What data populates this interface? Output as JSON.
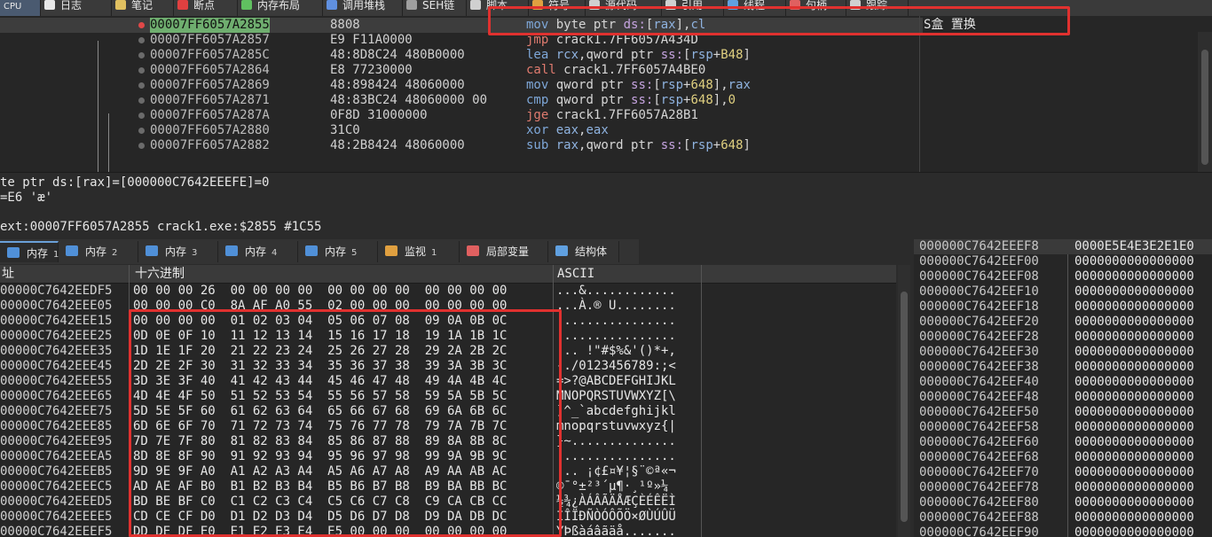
{
  "topbar": {
    "tabs": [
      {
        "label": "CPU",
        "icon": "cpu-icon",
        "color": "#5e8fd0"
      },
      {
        "label": "日志",
        "icon": "log-icon",
        "color": "#e8e8e8"
      },
      {
        "label": "笔记",
        "icon": "notes-icon",
        "color": "#e0c060"
      },
      {
        "label": "断点",
        "icon": "breakpoint-icon",
        "color": "#e04040"
      },
      {
        "label": "内存布局",
        "icon": "memory-map-icon",
        "color": "#60c060"
      },
      {
        "label": "调用堆栈",
        "icon": "call-stack-icon",
        "color": "#6090e0"
      },
      {
        "label": "SEH链",
        "icon": "seh-icon",
        "color": "#a0a0a0"
      },
      {
        "label": "脚本",
        "icon": "script-icon",
        "color": "#d0d0d0"
      },
      {
        "label": "符号",
        "icon": "symbol-icon",
        "color": "#e0a040"
      },
      {
        "label": "源代码",
        "icon": "source-icon",
        "color": "#d0d0d0"
      },
      {
        "label": "引用",
        "icon": "reference-icon",
        "color": "#d0d0d0"
      },
      {
        "label": "线程",
        "icon": "thread-icon",
        "color": "#60a0e0"
      },
      {
        "label": "句柄",
        "icon": "handle-icon",
        "color": "#e06060"
      },
      {
        "label": "跟踪",
        "icon": "trace-icon",
        "color": "#d0d0d0"
      }
    ]
  },
  "disasm": {
    "rip_label": "P",
    "rows": [
      {
        "addr": "00007FF6057A2855",
        "bytes": "8808",
        "ins": [
          [
            "mn",
            "mov"
          ],
          [
            "t",
            " byte ptr "
          ],
          [
            "seg",
            "ds:"
          ],
          [
            "t",
            "["
          ],
          [
            "reg",
            "rax"
          ],
          [
            "t",
            "],"
          ],
          [
            "reg",
            "cl"
          ]
        ],
        "current": true
      },
      {
        "addr": "00007FF6057A2857",
        "bytes": "E9 F11A0000",
        "ins": [
          [
            "mnj",
            "jmp"
          ],
          [
            "t",
            " crack1.7FF6057A434D"
          ]
        ]
      },
      {
        "addr": "00007FF6057A285C",
        "bytes": "48:8D8C24 480B0000",
        "ins": [
          [
            "mn",
            "lea"
          ],
          [
            "t",
            " "
          ],
          [
            "reg",
            "rcx"
          ],
          [
            "t",
            ",qword ptr "
          ],
          [
            "seg",
            "ss:"
          ],
          [
            "t",
            "["
          ],
          [
            "reg",
            "rsp"
          ],
          [
            "t",
            "+"
          ],
          [
            "num",
            "B48"
          ],
          [
            "t",
            "]"
          ]
        ]
      },
      {
        "addr": "00007FF6057A2864",
        "bytes": "E8 77230000",
        "ins": [
          [
            "mnc",
            "call"
          ],
          [
            "t",
            " crack1.7FF6057A4BE0"
          ]
        ]
      },
      {
        "addr": "00007FF6057A2869",
        "bytes": "48:898424 48060000",
        "ins": [
          [
            "mn",
            "mov"
          ],
          [
            "t",
            " qword ptr "
          ],
          [
            "seg",
            "ss:"
          ],
          [
            "t",
            "["
          ],
          [
            "reg",
            "rsp"
          ],
          [
            "t",
            "+"
          ],
          [
            "num",
            "648"
          ],
          [
            "t",
            "],"
          ],
          [
            "reg",
            "rax"
          ]
        ]
      },
      {
        "addr": "00007FF6057A2871",
        "bytes": "48:83BC24 48060000 00",
        "ins": [
          [
            "mn",
            "cmp"
          ],
          [
            "t",
            " qword ptr "
          ],
          [
            "seg",
            "ss:"
          ],
          [
            "t",
            "["
          ],
          [
            "reg",
            "rsp"
          ],
          [
            "t",
            "+"
          ],
          [
            "num",
            "648"
          ],
          [
            "t",
            "],"
          ],
          [
            "num",
            "0"
          ]
        ]
      },
      {
        "addr": "00007FF6057A287A",
        "bytes": "0F8D 31000000",
        "ins": [
          [
            "mnj",
            "jge"
          ],
          [
            "t",
            " crack1.7FF6057A28B1"
          ]
        ]
      },
      {
        "addr": "00007FF6057A2880",
        "bytes": "31C0",
        "ins": [
          [
            "mn",
            "xor"
          ],
          [
            "t",
            " "
          ],
          [
            "reg",
            "eax"
          ],
          [
            "t",
            ","
          ],
          [
            "reg",
            "eax"
          ]
        ]
      },
      {
        "addr": "00007FF6057A2882",
        "bytes": "48:2B8424 48060000",
        "ins": [
          [
            "mn",
            "sub"
          ],
          [
            "t",
            " "
          ],
          [
            "reg",
            "rax"
          ],
          [
            "t",
            ",qword ptr "
          ],
          [
            "seg",
            "ss:"
          ],
          [
            "t",
            "["
          ],
          [
            "reg",
            "rsp"
          ],
          [
            "t",
            "+"
          ],
          [
            "num",
            "648"
          ],
          [
            "t",
            "]"
          ]
        ]
      }
    ],
    "comment": "S盒 置换"
  },
  "info": {
    "line1": "te ptr ds:[rax]=[000000C7642EEEFE]=0",
    "line2": "=E6 'æ'",
    "line3": "ext:00007FF6057A2855 crack1.exe:$2855 #1C55"
  },
  "dumptabs": [
    {
      "label": "内存",
      "num": "1",
      "icon": "memory-icon",
      "color": "#5090d8",
      "active": true
    },
    {
      "label": "内存",
      "num": "2",
      "icon": "memory-icon",
      "color": "#5090d8"
    },
    {
      "label": "内存",
      "num": "3",
      "icon": "memory-icon",
      "color": "#5090d8"
    },
    {
      "label": "内存",
      "num": "4",
      "icon": "memory-icon",
      "color": "#5090d8"
    },
    {
      "label": "内存",
      "num": "5",
      "icon": "memory-icon",
      "color": "#5090d8"
    },
    {
      "label": "监视",
      "num": "1",
      "icon": "watch-icon",
      "color": "#e0a040"
    },
    {
      "label": "局部变量",
      "num": "",
      "icon": "locals-icon",
      "color": "#e06060"
    },
    {
      "label": "结构体",
      "num": "",
      "icon": "struct-icon",
      "color": "#60a0e0"
    }
  ],
  "dump": {
    "headers": {
      "addr": "址",
      "hex": "十六进制",
      "ascii": "ASCII"
    },
    "rows": [
      {
        "addr": "00000C7642EEDF5",
        "hex": "00 00 00 26  00 00 00 00  00 00 00 00  00 00 00 00",
        "ascii": "...&............"
      },
      {
        "addr": "00000C7642EEE05",
        "hex": "00 00 00 C0  8A AF A0 55  02 00 00 00  00 00 00 00",
        "ascii": "...À.® U........"
      },
      {
        "addr": "00000C7642EEE15",
        "hex": "00 00 00 00  01 02 03 04  05 06 07 08  09 0A 0B 0C",
        "ascii": "................"
      },
      {
        "addr": "00000C7642EEE25",
        "hex": "0D 0E 0F 10  11 12 13 14  15 16 17 18  19 1A 1B 1C",
        "ascii": "................"
      },
      {
        "addr": "00000C7642EEE35",
        "hex": "1D 1E 1F 20  21 22 23 24  25 26 27 28  29 2A 2B 2C",
        "ascii": "... !\"#$%&'()*+,"
      },
      {
        "addr": "00000C7642EEE45",
        "hex": "2D 2E 2F 30  31 32 33 34  35 36 37 38  39 3A 3B 3C",
        "ascii": "-./0123456789:;<"
      },
      {
        "addr": "00000C7642EEE55",
        "hex": "3D 3E 3F 40  41 42 43 44  45 46 47 48  49 4A 4B 4C",
        "ascii": "=>?@ABCDEFGHIJKL"
      },
      {
        "addr": "00000C7642EEE65",
        "hex": "4D 4E 4F 50  51 52 53 54  55 56 57 58  59 5A 5B 5C",
        "ascii": "MNOPQRSTUVWXYZ[\\"
      },
      {
        "addr": "00000C7642EEE75",
        "hex": "5D 5E 5F 60  61 62 63 64  65 66 67 68  69 6A 6B 6C",
        "ascii": "]^_`abcdefghijkl"
      },
      {
        "addr": "00000C7642EEE85",
        "hex": "6D 6E 6F 70  71 72 73 74  75 76 77 78  79 7A 7B 7C",
        "ascii": "mnopqrstuvwxyz{|"
      },
      {
        "addr": "00000C7642EEE95",
        "hex": "7D 7E 7F 80  81 82 83 84  85 86 87 88  89 8A 8B 8C",
        "ascii": "}~.............."
      },
      {
        "addr": "00000C7642EEEA5",
        "hex": "8D 8E 8F 90  91 92 93 94  95 96 97 98  99 9A 9B 9C",
        "ascii": "................"
      },
      {
        "addr": "00000C7642EEEB5",
        "hex": "9D 9E 9F A0  A1 A2 A3 A4  A5 A6 A7 A8  A9 AA AB AC",
        "ascii": "... ¡¢£¤¥¦§¨©ª«¬"
      },
      {
        "addr": "00000C7642EEEC5",
        "hex": "AD AE AF B0  B1 B2 B3 B4  B5 B6 B7 B8  B9 BA BB BC",
        "ascii": "®¯°±²³´µ¶·¸¹º»¼"
      },
      {
        "addr": "00000C7642EEED5",
        "hex": "BD BE BF C0  C1 C2 C3 C4  C5 C6 C7 C8  C9 CA CB CC",
        "ascii": "½¾¿ÀÁÂÃÄÅÆÇÈÉÊËÌ"
      },
      {
        "addr": "00000C7642EEEE5",
        "hex": "CD CE CF D0  D1 D2 D3 D4  D5 D6 D7 D8  D9 DA DB DC",
        "ascii": "ÍÎÏÐÑÒÓÔÕÖ×ØÙÚÛÜ"
      },
      {
        "addr": "00000C7642EEEF5",
        "hex": "DD DE DF E0  E1 E2 E3 E4  E5 00 00 00  00 00 00 00",
        "ascii": "ÝÞßàáâãäå......."
      }
    ]
  },
  "stack": {
    "rows": [
      {
        "addr": "000000C7642EEEF8",
        "val": "0000E5E4E3E2E1E0",
        "selected": true
      },
      {
        "addr": "000000C7642EEF00",
        "val": "0000000000000000"
      },
      {
        "addr": "000000C7642EEF08",
        "val": "0000000000000000"
      },
      {
        "addr": "000000C7642EEF10",
        "val": "0000000000000000"
      },
      {
        "addr": "000000C7642EEF18",
        "val": "0000000000000000"
      },
      {
        "addr": "000000C7642EEF20",
        "val": "0000000000000000"
      },
      {
        "addr": "000000C7642EEF28",
        "val": "0000000000000000"
      },
      {
        "addr": "000000C7642EEF30",
        "val": "0000000000000000"
      },
      {
        "addr": "000000C7642EEF38",
        "val": "0000000000000000"
      },
      {
        "addr": "000000C7642EEF40",
        "val": "0000000000000000"
      },
      {
        "addr": "000000C7642EEF48",
        "val": "0000000000000000"
      },
      {
        "addr": "000000C7642EEF50",
        "val": "0000000000000000"
      },
      {
        "addr": "000000C7642EEF58",
        "val": "0000000000000000"
      },
      {
        "addr": "000000C7642EEF60",
        "val": "0000000000000000"
      },
      {
        "addr": "000000C7642EEF68",
        "val": "0000000000000000"
      },
      {
        "addr": "000000C7642EEF70",
        "val": "0000000000000000"
      },
      {
        "addr": "000000C7642EEF78",
        "val": "0000000000000000"
      },
      {
        "addr": "000000C7642EEF80",
        "val": "0000000000000000"
      },
      {
        "addr": "000000C7642EEF88",
        "val": "0000000000000000"
      },
      {
        "addr": "000000C7642EEF90",
        "val": "0000000000000000"
      }
    ]
  },
  "colors": {
    "highlight_box": "#e0312f",
    "current_line": "#6fae6f"
  }
}
